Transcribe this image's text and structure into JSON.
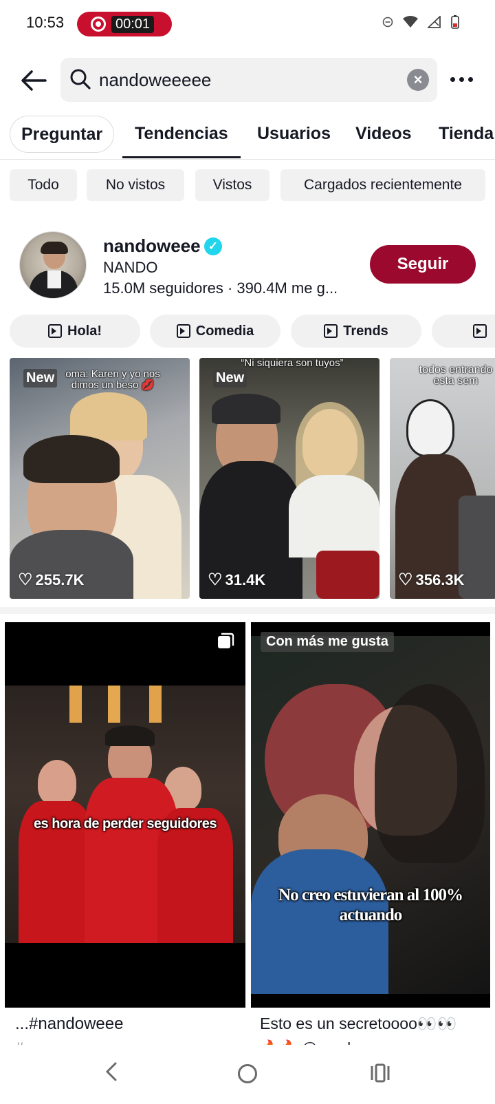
{
  "status_bar": {
    "time": "10:53",
    "rec_timer": "00:01"
  },
  "search": {
    "query": "nandoweeeee"
  },
  "tabs": [
    {
      "label": "Preguntar"
    },
    {
      "label": "Tendencias"
    },
    {
      "label": "Usuarios"
    },
    {
      "label": "Videos"
    },
    {
      "label": "Tienda"
    }
  ],
  "filters": [
    "Todo",
    "No vistos",
    "Vistos",
    "Cargados recientemente"
  ],
  "user": {
    "username": "nandoweee",
    "nickname": "NANDO",
    "stats": "15.0M seguidores · 390.4M me g...",
    "follow_label": "Seguir"
  },
  "playlists": [
    "Hola!",
    "Comedia",
    "Trends"
  ],
  "thumbnails": [
    {
      "badge": "New",
      "caption": "oma: Karen y yo nos dimos un beso 💋",
      "likes": "255.7K"
    },
    {
      "badge": "New",
      "caption": "“Ni siquiera son tuyos”",
      "likes": "31.4K"
    },
    {
      "badge": "",
      "caption": "todos entrando esta sem",
      "likes": "356.3K"
    }
  ],
  "cards": [
    {
      "overlay": "es hora de perder seguidores",
      "title": "...#nandoweee",
      "subtitle": "#..."
    },
    {
      "tag": "Con más me gusta",
      "overlay": "No creo estuvieran al 100% actuando",
      "title": "Esto es un secretoooo👀👀",
      "subtitle": "🔥🔥 @nandoweee"
    }
  ],
  "colors": {
    "follow": "#9b0a2e",
    "verified": "#20d5ec",
    "rec": "#c8102e"
  }
}
